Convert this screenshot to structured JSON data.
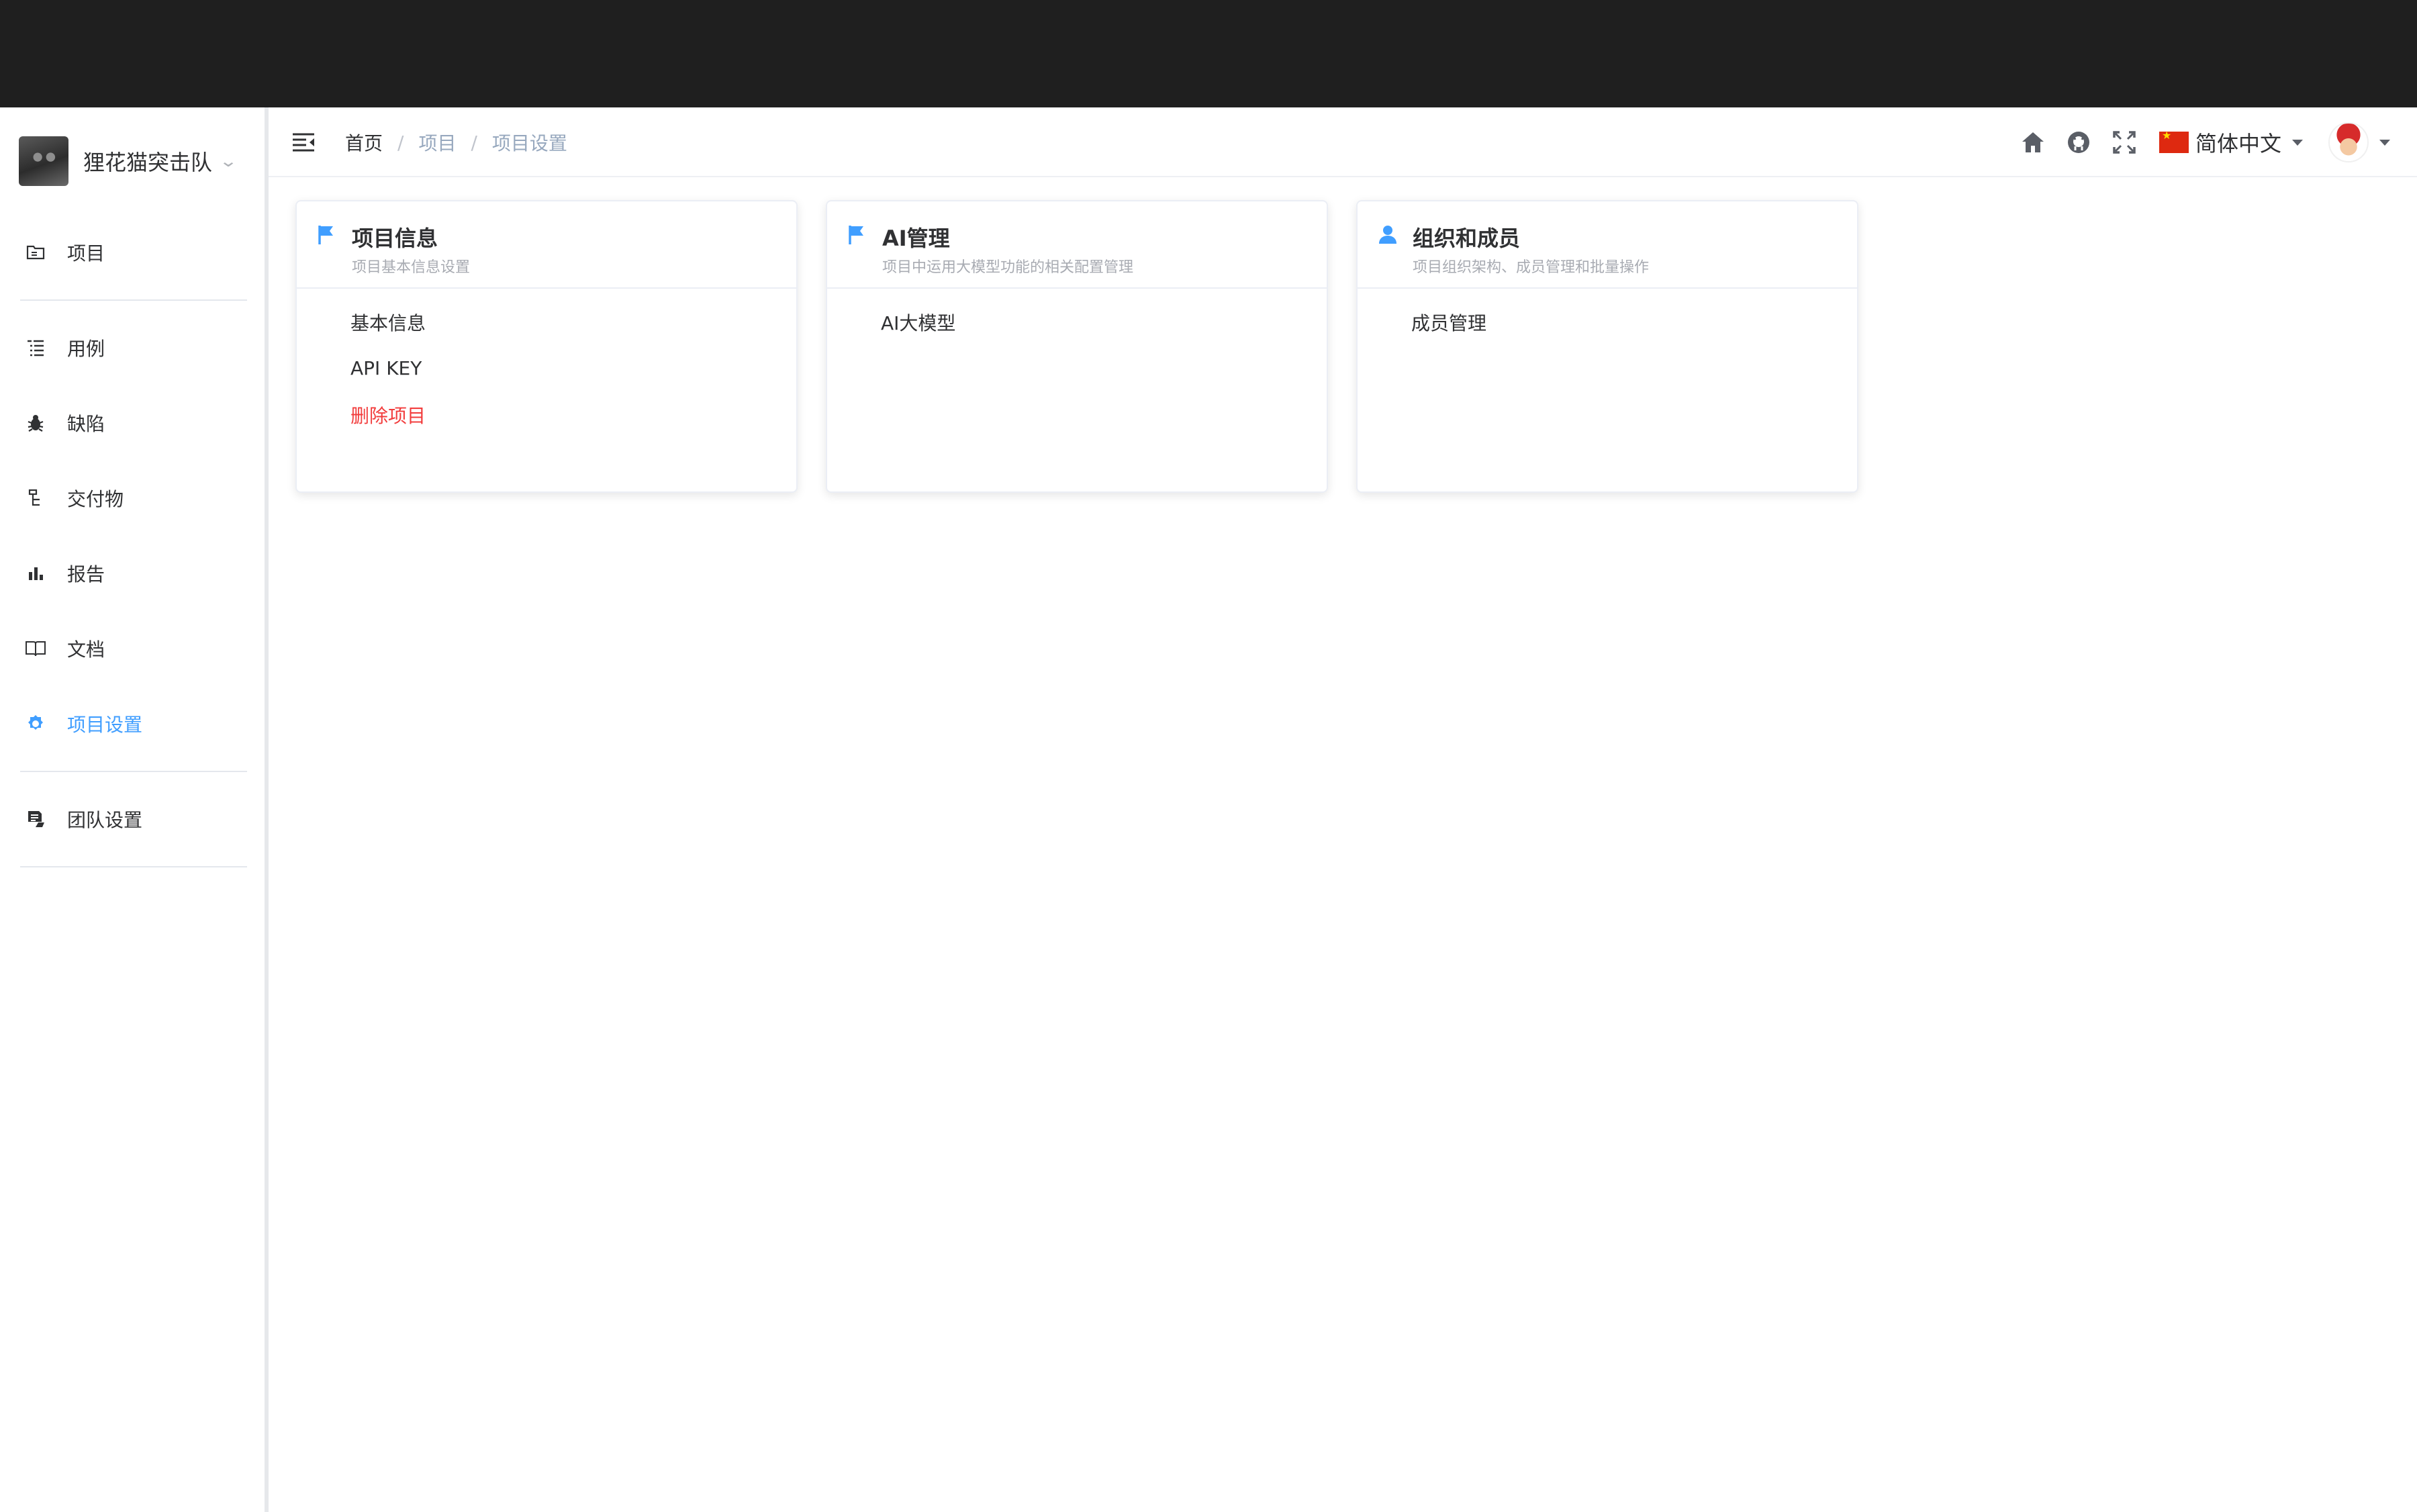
{
  "sidebar": {
    "team_name": "狸花猫突击队",
    "items": [
      {
        "label": "项目",
        "icon": "folder-icon"
      },
      {
        "label": "用例",
        "icon": "list-icon"
      },
      {
        "label": "缺陷",
        "icon": "bug-icon"
      },
      {
        "label": "交付物",
        "icon": "tree-icon"
      },
      {
        "label": "报告",
        "icon": "bar-chart-icon"
      },
      {
        "label": "文档",
        "icon": "book-icon"
      },
      {
        "label": "项目设置",
        "icon": "gear-icon",
        "active": true
      },
      {
        "label": "团队设置",
        "icon": "team-settings-icon"
      }
    ]
  },
  "navbar": {
    "breadcrumb": [
      "首页",
      "项目",
      "项目设置"
    ],
    "breadcrumb_separator": "/",
    "language": "简体中文"
  },
  "cards": [
    {
      "title": "项目信息",
      "subtitle": "项目基本信息设置",
      "icon": "flag-icon",
      "links": [
        {
          "label": "基本信息"
        },
        {
          "label": "API KEY"
        },
        {
          "label": "删除项目",
          "danger": true
        }
      ]
    },
    {
      "title": "AI管理",
      "subtitle": "项目中运用大模型功能的相关配置管理",
      "icon": "flag-icon",
      "links": [
        {
          "label": "AI大模型"
        }
      ]
    },
    {
      "title": "组织和成员",
      "subtitle": "项目组织架构、成员管理和批量操作",
      "icon": "user-icon",
      "links": [
        {
          "label": "成员管理"
        }
      ]
    }
  ],
  "colors": {
    "accent": "#409eff",
    "danger": "#f23c3c",
    "topbar": "#1f1f1f",
    "breadcrumb_link": "#97a8be"
  }
}
